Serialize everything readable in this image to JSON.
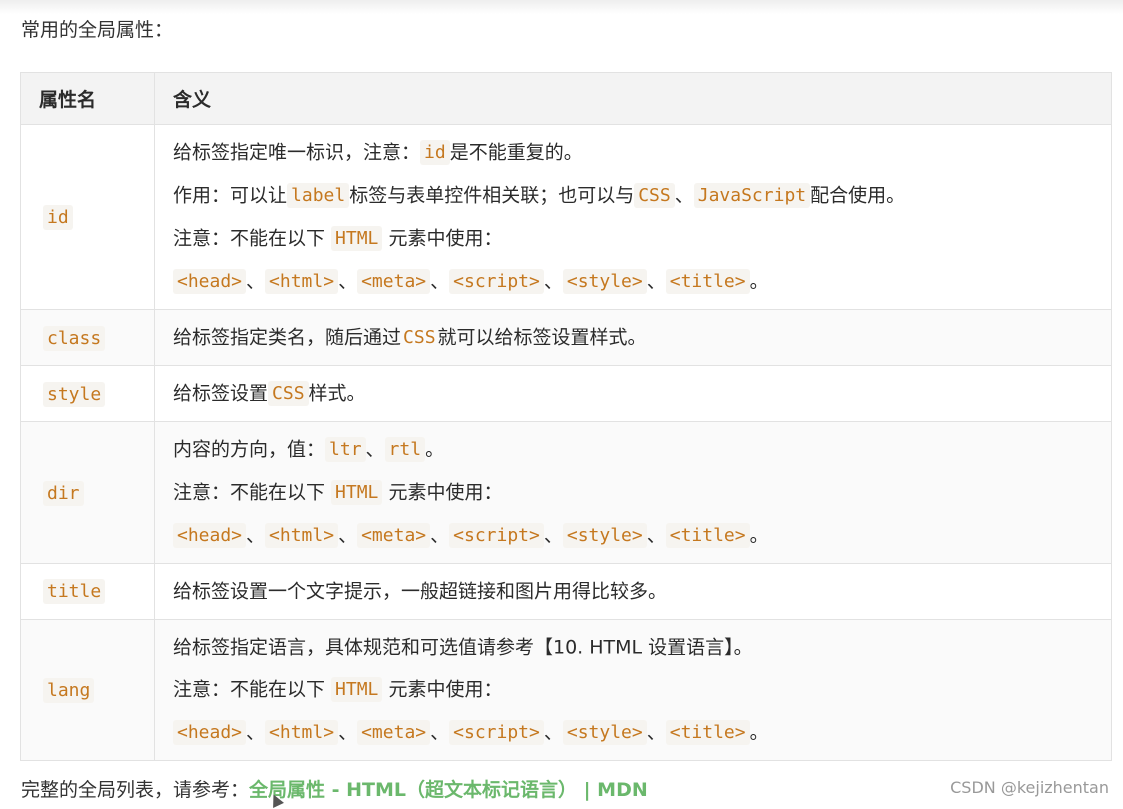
{
  "intro": "常用的全局属性：",
  "table": {
    "headers": [
      "属性名",
      "含义"
    ],
    "rows": [
      {
        "name": "id",
        "lines": [
          [
            {
              "t": "text",
              "v": "给标签指定唯一标识，注意："
            },
            {
              "t": "code",
              "v": "id"
            },
            {
              "t": "text",
              "v": "是不能重复的。"
            }
          ],
          [
            {
              "t": "text",
              "v": "作用：可以让"
            },
            {
              "t": "code",
              "v": "label"
            },
            {
              "t": "text",
              "v": "标签与表单控件相关联；也可以与"
            },
            {
              "t": "code",
              "v": "CSS"
            },
            {
              "t": "text",
              "v": "、"
            },
            {
              "t": "code",
              "v": "JavaScript"
            },
            {
              "t": "text",
              "v": "配合使用。"
            }
          ],
          [
            {
              "t": "text",
              "v": "注意：不能在以下 "
            },
            {
              "t": "code",
              "v": "HTML"
            },
            {
              "t": "text",
              "v": " 元素中使用："
            }
          ],
          [
            {
              "t": "code",
              "v": "<head>"
            },
            {
              "t": "text",
              "v": "、"
            },
            {
              "t": "code",
              "v": "<html>"
            },
            {
              "t": "text",
              "v": "、"
            },
            {
              "t": "code",
              "v": "<meta>"
            },
            {
              "t": "text",
              "v": "、"
            },
            {
              "t": "code",
              "v": "<script>"
            },
            {
              "t": "text",
              "v": "、"
            },
            {
              "t": "code",
              "v": "<style>"
            },
            {
              "t": "text",
              "v": "、"
            },
            {
              "t": "code",
              "v": "<title>"
            },
            {
              "t": "text",
              "v": "。"
            }
          ]
        ]
      },
      {
        "name": "class",
        "lines": [
          [
            {
              "t": "text",
              "v": "给标签指定类名，随后通过"
            },
            {
              "t": "codeplain",
              "v": "CSS"
            },
            {
              "t": "text",
              "v": "就可以给标签设置样式。"
            }
          ]
        ]
      },
      {
        "name": "style",
        "lines": [
          [
            {
              "t": "text",
              "v": "给标签设置"
            },
            {
              "t": "code",
              "v": "CSS"
            },
            {
              "t": "text",
              "v": "样式。"
            }
          ]
        ]
      },
      {
        "name": "dir",
        "lines": [
          [
            {
              "t": "text",
              "v": "内容的方向，值："
            },
            {
              "t": "code",
              "v": "ltr"
            },
            {
              "t": "text",
              "v": "、"
            },
            {
              "t": "code",
              "v": "rtl"
            },
            {
              "t": "text",
              "v": "。"
            }
          ],
          [
            {
              "t": "text",
              "v": "注意：不能在以下 "
            },
            {
              "t": "code",
              "v": "HTML"
            },
            {
              "t": "text",
              "v": " 元素中使用："
            }
          ],
          [
            {
              "t": "code",
              "v": "<head>"
            },
            {
              "t": "text",
              "v": "、"
            },
            {
              "t": "code",
              "v": "<html>"
            },
            {
              "t": "text",
              "v": "、"
            },
            {
              "t": "code",
              "v": "<meta>"
            },
            {
              "t": "text",
              "v": "、"
            },
            {
              "t": "code",
              "v": "<script>"
            },
            {
              "t": "text",
              "v": "、"
            },
            {
              "t": "code",
              "v": "<style>"
            },
            {
              "t": "text",
              "v": "、"
            },
            {
              "t": "code",
              "v": "<title>"
            },
            {
              "t": "text",
              "v": "。"
            }
          ]
        ]
      },
      {
        "name": "title",
        "lines": [
          [
            {
              "t": "text",
              "v": "给标签设置一个文字提示，一般超链接和图片用得比较多。"
            }
          ]
        ]
      },
      {
        "name": "lang",
        "lines": [
          [
            {
              "t": "text",
              "v": "给标签指定语言，具体规范和可选值请参考【10. HTML 设置语言】。"
            }
          ],
          [
            {
              "t": "text",
              "v": "注意：不能在以下 "
            },
            {
              "t": "code",
              "v": "HTML"
            },
            {
              "t": "text",
              "v": " 元素中使用："
            }
          ],
          [
            {
              "t": "code",
              "v": "<head>"
            },
            {
              "t": "text",
              "v": "、"
            },
            {
              "t": "code",
              "v": "<html>"
            },
            {
              "t": "text",
              "v": "、"
            },
            {
              "t": "code",
              "v": "<meta>"
            },
            {
              "t": "text",
              "v": "、"
            },
            {
              "t": "code",
              "v": "<script>"
            },
            {
              "t": "text",
              "v": "、"
            },
            {
              "t": "code",
              "v": "<style>"
            },
            {
              "t": "text",
              "v": "、"
            },
            {
              "t": "code",
              "v": "<title>"
            },
            {
              "t": "text",
              "v": "。"
            }
          ]
        ]
      }
    ]
  },
  "footer": {
    "text": "完整的全局列表，请参考：",
    "link": "全局属性 - HTML（超文本标记语言） | MDN"
  },
  "watermark": "CSDN @kejizhentan",
  "colors": {
    "code": "#c5781f",
    "link": "#6bb86c",
    "header_bg": "#f3f3f3"
  }
}
